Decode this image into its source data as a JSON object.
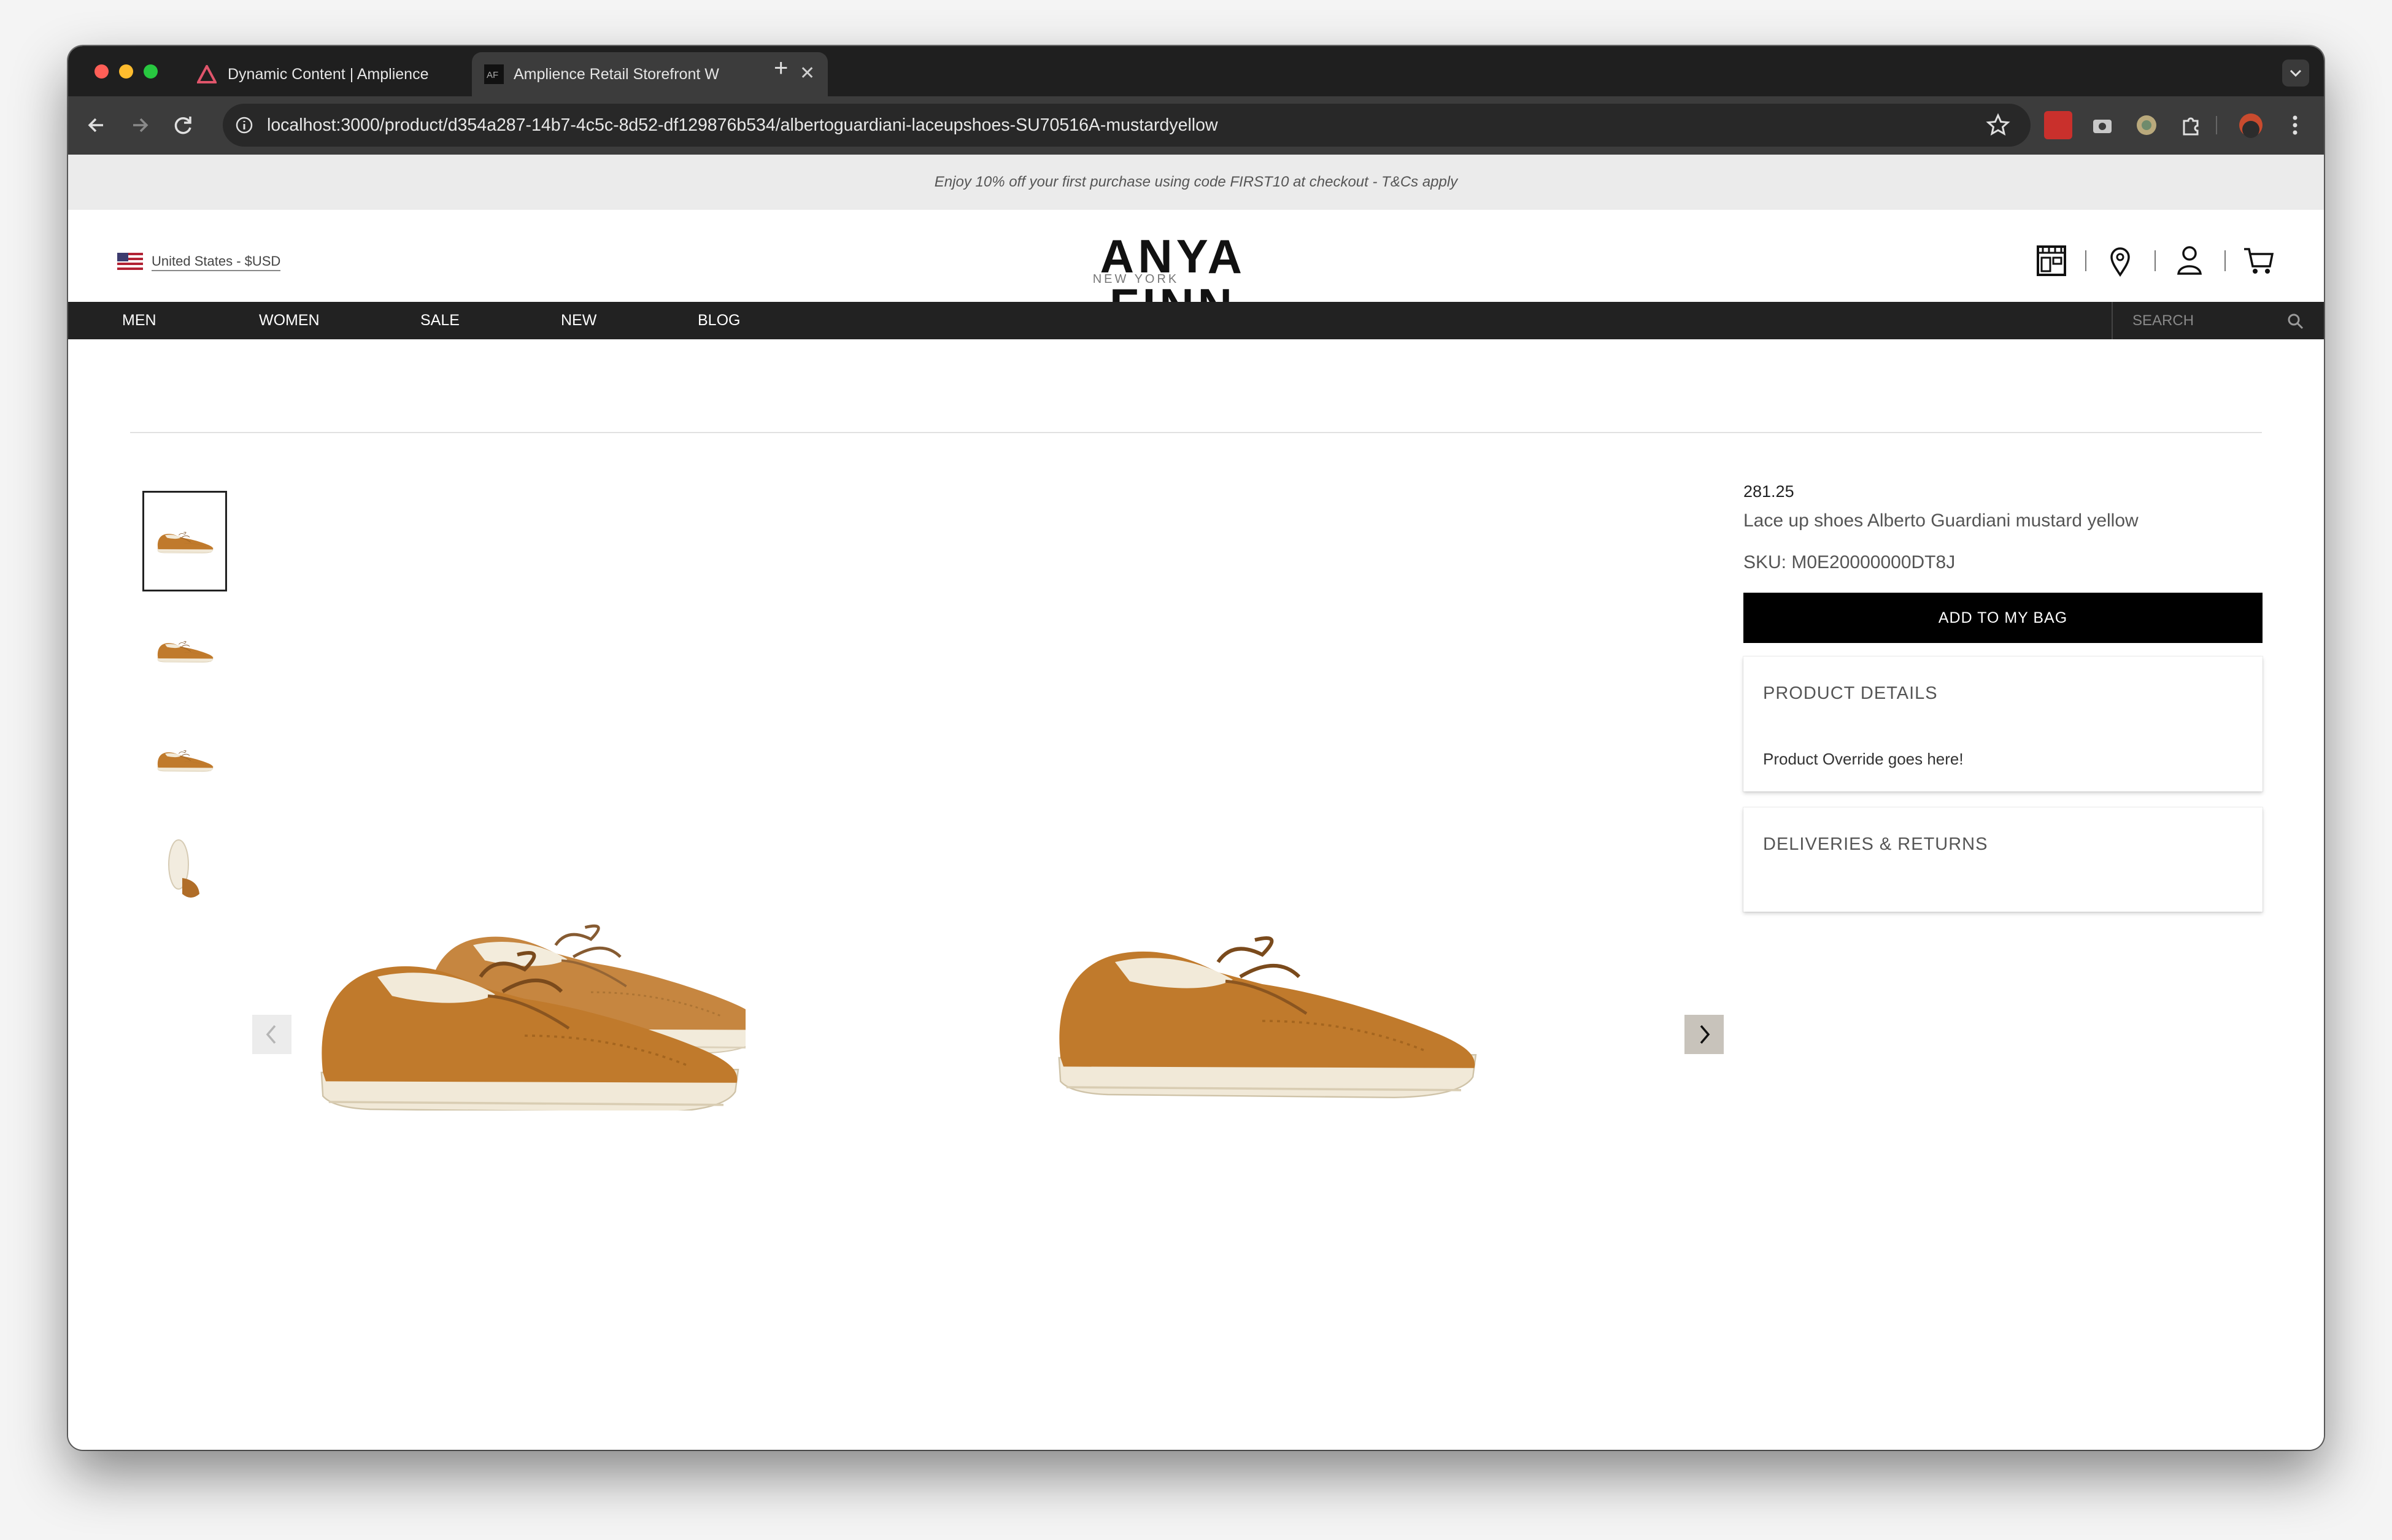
{
  "browser": {
    "tabs": [
      {
        "title": "Dynamic Content | Amplience",
        "active": false
      },
      {
        "title": "Amplience Retail Storefront W",
        "active": true
      }
    ],
    "new_tab_label": "+",
    "close_glyph": "✕",
    "url": "localhost:3000/product/d354a287-14b7-4c5c-8d52-df129876b534/albertoguardiani-laceupshoes-SU70516A-mustardyellow",
    "icons": [
      "back-icon",
      "forward-icon",
      "reload-icon",
      "site-info-icon",
      "bookmark-star-icon",
      "extension-icon",
      "camera-icon",
      "extension-icon",
      "puzzle-icon",
      "profile-avatar",
      "menu-icon",
      "tab-search-icon"
    ]
  },
  "promo": {
    "text": "Enjoy 10% off your first purchase using code FIRST10 at checkout - T&Cs apply"
  },
  "header": {
    "region": "United States - $USD",
    "logo": {
      "main": "ANYA FINN",
      "sub": "NEW YORK"
    },
    "icons": [
      "store-icon",
      "location-pin-icon",
      "account-icon",
      "cart-icon"
    ]
  },
  "nav": {
    "links": [
      "MEN",
      "WOMEN",
      "SALE",
      "NEW",
      "BLOG"
    ],
    "search_placeholder": "SEARCH"
  },
  "product": {
    "price": "281.25",
    "name": "Lace up shoes Alberto Guardiani mustard yellow",
    "sku": "SKU: M0E20000000DT8J",
    "add_to_bag": "ADD TO MY BAG",
    "thumbnail_count": 4,
    "panels": [
      {
        "title": "PRODUCT DETAILS",
        "body": "Product Override goes here!"
      },
      {
        "title": "DELIVERIES & RETURNS",
        "body": ""
      }
    ]
  },
  "colors": {
    "shoe": "#c07a2c",
    "nav_bg": "#222222",
    "promo_bg": "#ebebeb",
    "button_bg": "#000000"
  }
}
